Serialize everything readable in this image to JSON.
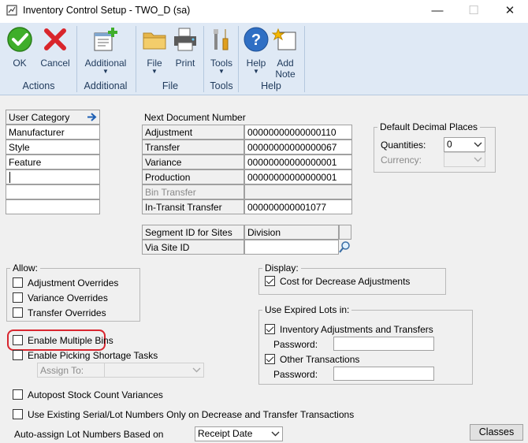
{
  "window": {
    "title": "Inventory Control Setup  -  TWO_D (sa)",
    "minimize_glyph": "—",
    "maximize_glyph": "☐",
    "close_glyph": "✕"
  },
  "ribbon": {
    "groups": {
      "actions": "Actions",
      "additional": "Additional",
      "file": "File",
      "tools": "Tools",
      "help": "Help"
    },
    "buttons": {
      "ok": "OK",
      "cancel": "Cancel",
      "additional": "Additional",
      "file": "File",
      "print": "Print",
      "tools": "Tools",
      "help": "Help",
      "add_note_1": "Add",
      "add_note_2": "Note"
    },
    "caret": "▼"
  },
  "user_category": {
    "header": "User Category",
    "rows": [
      "Manufacturer",
      "Style",
      "Feature",
      "",
      "",
      ""
    ]
  },
  "next_document": {
    "title": "Next Document Number",
    "rows": [
      {
        "label": "Adjustment",
        "value": "00000000000000110"
      },
      {
        "label": "Transfer",
        "value": "00000000000000067"
      },
      {
        "label": "Variance",
        "value": "00000000000000001"
      },
      {
        "label": "Production",
        "value": "00000000000000001"
      },
      {
        "label": "Bin Transfer",
        "value": ""
      },
      {
        "label": "In-Transit Transfer",
        "value": "000000000001077"
      }
    ]
  },
  "decimal_places": {
    "title": "Default Decimal Places",
    "quantities_label": "Quantities:",
    "quantities_value": "0",
    "currency_label": "Currency:",
    "currency_value": ""
  },
  "segment": {
    "segment_label": "Segment ID for Sites",
    "segment_value": "Division",
    "via_label": "Via Site ID",
    "via_value": ""
  },
  "allow": {
    "title": "Allow:",
    "items": [
      "Adjustment Overrides",
      "Variance Overrides",
      "Transfer Overrides"
    ]
  },
  "display": {
    "title": "Display:",
    "cost_label": "Cost for Decrease Adjustments"
  },
  "expired": {
    "title": "Use Expired Lots in:",
    "inv_adj_label": "Inventory Adjustments and Transfers",
    "password_label": "Password:",
    "other_label": "Other Transactions",
    "password2_label": "Password:"
  },
  "options": {
    "enable_multiple_bins": "Enable Multiple Bins",
    "enable_picking": "Enable Picking Shortage Tasks",
    "assign_to": "Assign To:",
    "autopost": "Autopost Stock Count Variances",
    "use_existing": "Use Existing Serial/Lot Numbers Only on Decrease and Transfer Transactions",
    "auto_assign_label": "Auto-assign Lot Numbers Based on",
    "auto_assign_value": "Receipt Date"
  },
  "classes_button": "Classes"
}
